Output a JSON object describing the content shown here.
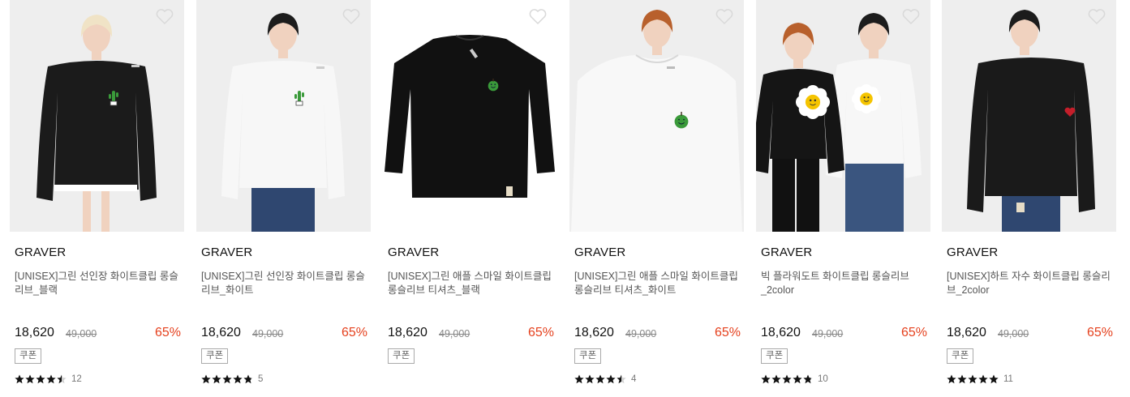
{
  "products": [
    {
      "brand": "GRAVER",
      "name": "[UNISEX]그린 선인장 화이트클립 롱슬리브_블랙",
      "price": "18,620",
      "original_price": "49,000",
      "discount": "65%",
      "coupon": "쿠폰",
      "rating": 4.5,
      "review_count": "12",
      "image": {
        "model": "female",
        "bg": "#eeeeee",
        "shirt": "#1b1b1b",
        "motif": "cactus",
        "motif_color": "#3a9a3a"
      }
    },
    {
      "brand": "GRAVER",
      "name": "[UNISEX]그린 선인장 화이트클립 롱슬리브_화이트",
      "price": "18,620",
      "original_price": "49,000",
      "discount": "65%",
      "coupon": "쿠폰",
      "rating": 4.8,
      "review_count": "5",
      "image": {
        "model": "male",
        "bg": "#eeeeee",
        "shirt": "#f7f7f7",
        "motif": "cactus",
        "motif_color": "#3a9a3a"
      }
    },
    {
      "brand": "GRAVER",
      "name": "[UNISEX]그린 애플 스마일 화이트클립 롱슬리브 티셔츠_블랙",
      "price": "18,620",
      "original_price": "49,000",
      "discount": "65%",
      "coupon": "쿠폰",
      "rating": null,
      "review_count": null,
      "image": {
        "model": "flat",
        "bg": "#ffffff",
        "shirt": "#111111",
        "motif": "apple",
        "motif_color": "#3a9a3a"
      }
    },
    {
      "brand": "GRAVER",
      "name": "[UNISEX]그린 애플 스마일 화이트클립 롱슬리브 티셔츠_화이트",
      "price": "18,620",
      "original_price": "49,000",
      "discount": "65%",
      "coupon": "쿠폰",
      "rating": 4.5,
      "review_count": "4",
      "image": {
        "model": "closeup",
        "bg": "#eeeeee",
        "shirt": "#f8f8f8",
        "motif": "apple",
        "motif_color": "#3a9a3a"
      }
    },
    {
      "brand": "GRAVER",
      "name": "빅 플라워도트 화이트클립 롱슬리브_2color",
      "price": "18,620",
      "original_price": "49,000",
      "discount": "65%",
      "coupon": "쿠폰",
      "rating": 4.8,
      "review_count": "10",
      "image": {
        "model": "couple",
        "bg": "#eeeeee",
        "shirt": "#151515",
        "motif": "flower",
        "motif_color": "#f5c400"
      }
    },
    {
      "brand": "GRAVER",
      "name": "[UNISEX]하트 자수 화이트클립 롱슬리브_2color",
      "price": "18,620",
      "original_price": "49,000",
      "discount": "65%",
      "coupon": "쿠폰",
      "rating": 5,
      "review_count": "11",
      "image": {
        "model": "male-side",
        "bg": "#eeeeee",
        "shirt": "#1a1a1a",
        "motif": "heart",
        "motif_color": "#c41e2a"
      }
    }
  ],
  "colors": {
    "discount": "#e5411e",
    "star": "#111111",
    "text": "#111111",
    "muted": "#888888"
  }
}
